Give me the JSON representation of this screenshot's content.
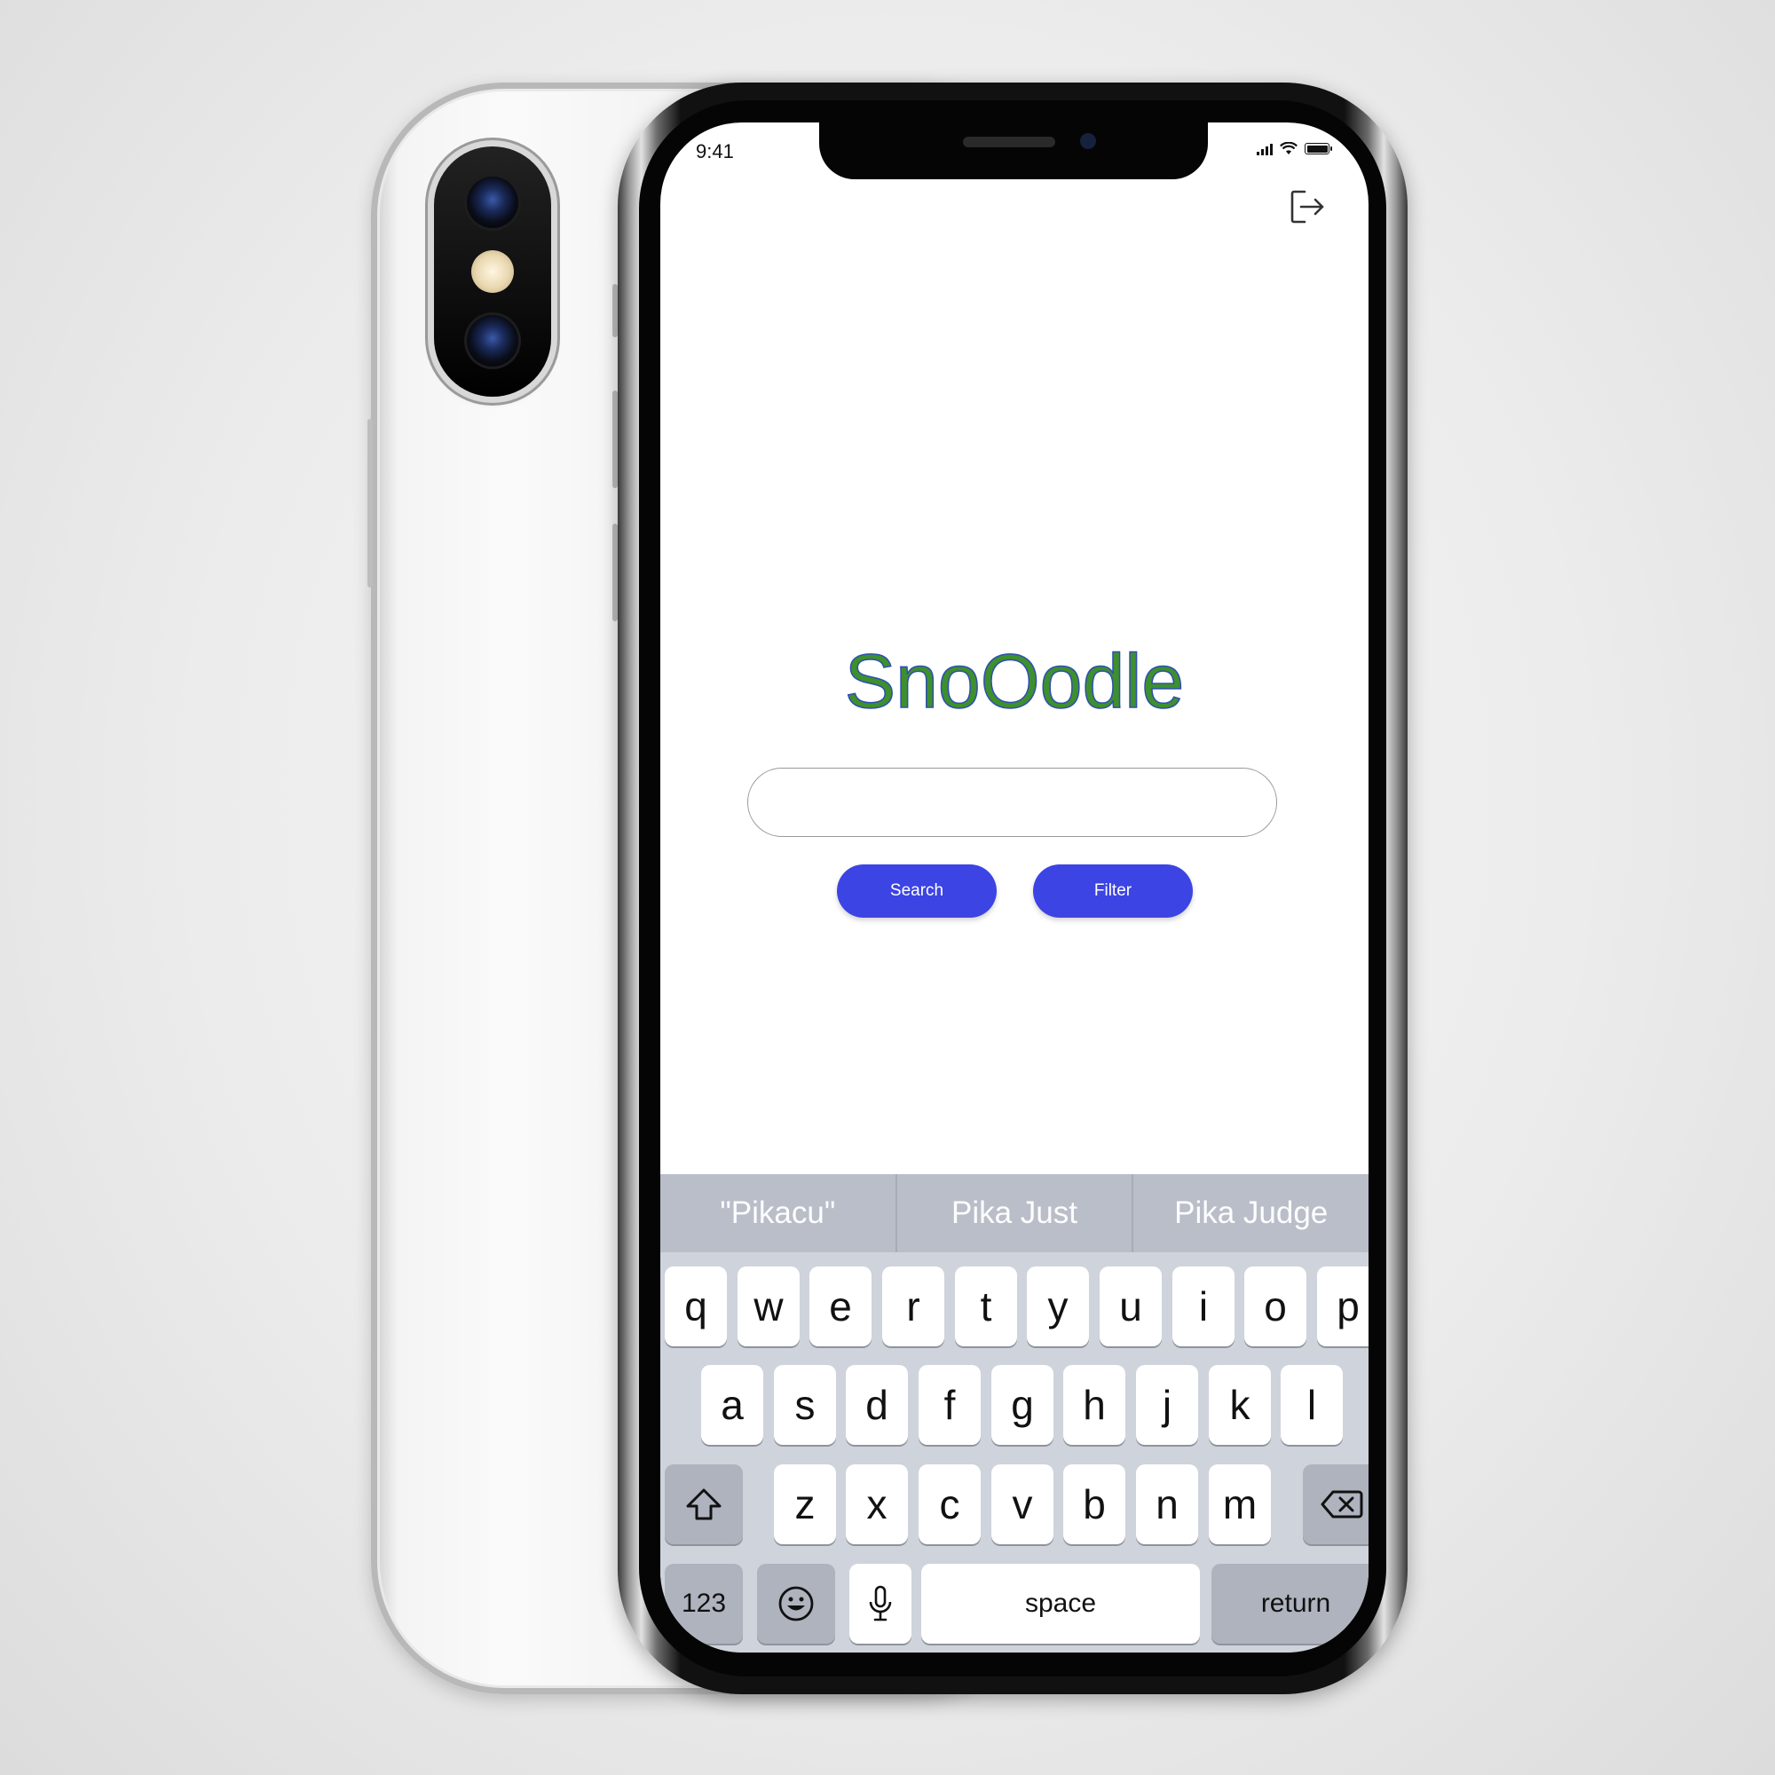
{
  "status_bar": {
    "time": "9:41"
  },
  "app": {
    "brand": "SnoOodle",
    "search": {
      "value": "",
      "placeholder": ""
    },
    "buttons": {
      "search": "Search",
      "filter": "Filter"
    }
  },
  "icons": {
    "logout": "logout-icon",
    "search": "search-icon",
    "shift": "shift-icon",
    "backspace": "backspace-icon",
    "emoji": "emoji-icon",
    "mic": "microphone-icon"
  },
  "colors": {
    "accent": "#3c44e4",
    "brand_fill": "#3e8f2e",
    "brand_outline": "#2e4fb0",
    "keyboard_bg": "#cfd3db",
    "suggestion_bar": "#b9bec9"
  },
  "keyboard": {
    "suggestions": [
      "\"Pikacu\"",
      "Pika Just",
      "Pika Judge"
    ],
    "row1": [
      "q",
      "w",
      "e",
      "r",
      "t",
      "y",
      "u",
      "i",
      "o",
      "p"
    ],
    "row2": [
      "a",
      "s",
      "d",
      "f",
      "g",
      "h",
      "j",
      "k",
      "l"
    ],
    "row3": [
      "z",
      "x",
      "c",
      "v",
      "b",
      "n",
      "m"
    ],
    "numbers_label": "123",
    "space_label": "space",
    "return_label": "return"
  }
}
